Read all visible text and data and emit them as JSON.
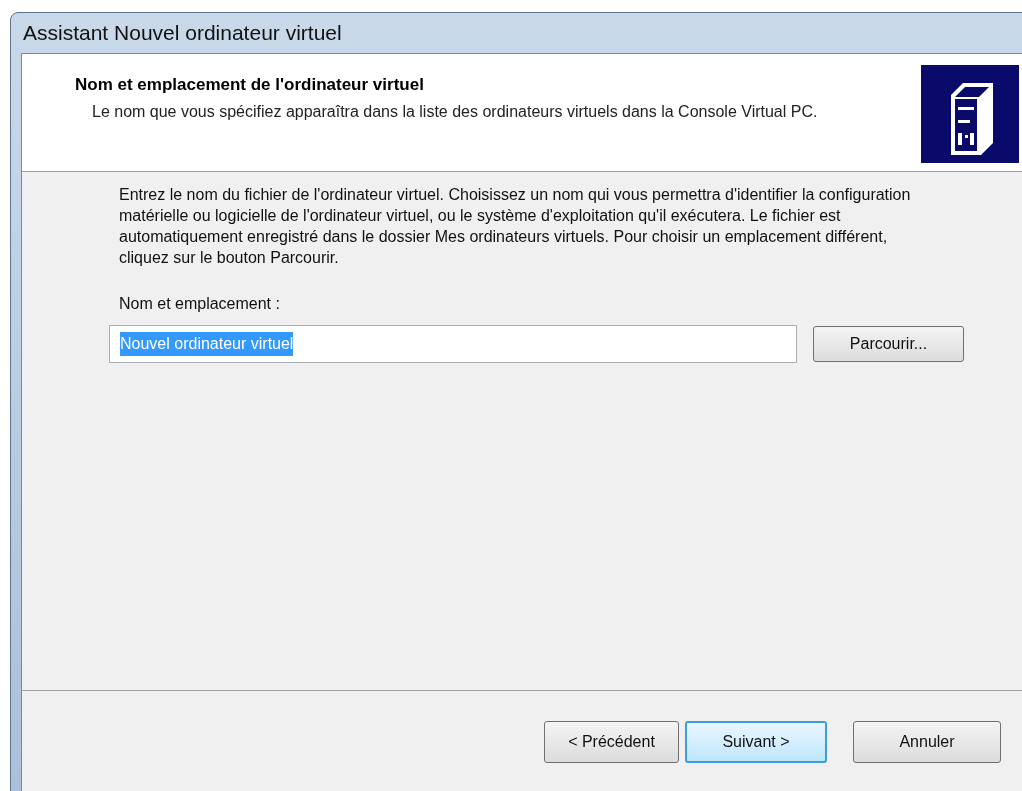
{
  "window": {
    "title": "Assistant Nouvel ordinateur virtuel"
  },
  "header": {
    "title": "Nom et emplacement de l'ordinateur virtuel",
    "subtitle": "Le nom que vous spécifiez apparaîtra dans la liste des ordinateurs virtuels dans la Console Virtual PC."
  },
  "body": {
    "description": "Entrez le nom du fichier de l'ordinateur virtuel. Choisissez un nom qui vous permettra d'identifier la configuration matérielle ou logicielle de l'ordinateur virtuel, ou le système d'exploitation qu'il exécutera. Le fichier est automatiquement enregistré dans le dossier Mes ordinateurs virtuels. Pour choisir un emplacement différent, cliquez sur le bouton Parcourir.",
    "field_label": "Nom et emplacement :",
    "field": {
      "value": "Nouvel ordinateur virtuel",
      "selected": true
    },
    "browse_button": "Parcourir..."
  },
  "buttons": [
    {
      "label": "< Précédent",
      "default": false
    },
    {
      "label": "Suivant >",
      "default": true
    },
    {
      "label": "Annuler",
      "default": false
    }
  ]
}
